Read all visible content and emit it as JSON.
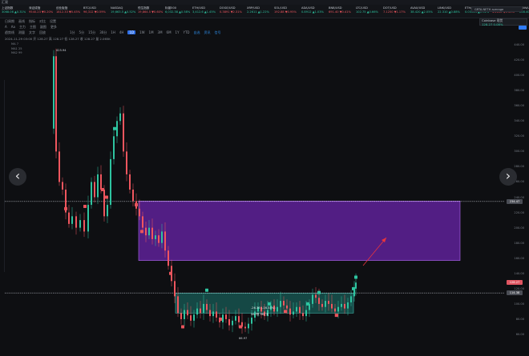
{
  "app_title": "汇观",
  "ticker": [
    {
      "name": "上证指数",
      "value": "3068.06 ▲0.31%",
      "dir": "up"
    },
    {
      "name": "深证成指",
      "value": "9540.23 ▼0.20%",
      "dir": "dn"
    },
    {
      "name": "创业板指",
      "value": "1812.33 ▼0.45%",
      "dir": "dn"
    },
    {
      "name": "BTC/USD",
      "value": "96,312 ▼0.59%",
      "dir": "dn"
    },
    {
      "name": "NASDAQ",
      "value": "19,663.5 ▲0.52%",
      "dir": "up"
    },
    {
      "name": "恒生指数",
      "value": "19,864.5 ▼0.60%",
      "dir": "dn"
    },
    {
      "name": "标普500",
      "value": "6,032.38 ▲0.58%",
      "dir": "up"
    },
    {
      "name": "ETH/USD",
      "value": "3,412.6 ▲1.45%",
      "dir": "up"
    },
    {
      "name": "DOGE/USD",
      "value": "0.3891 ▼2.31%",
      "dir": "dn"
    },
    {
      "name": "XRP/USD",
      "value": "2.2611 ▲1.22%",
      "dir": "up"
    },
    {
      "name": "SOL/USD",
      "value": "192.88 ▼0.95%",
      "dir": "dn"
    },
    {
      "name": "ADA/USD",
      "value": "0.8912 ▲1.03%",
      "dir": "up"
    },
    {
      "name": "BNB/USD",
      "value": "691.40 ▼0.41%",
      "dir": "dn"
    },
    {
      "name": "LTC/USD",
      "value": "102.75 ▲0.66%",
      "dir": "up"
    },
    {
      "name": "DOT/USD",
      "value": "7.1250 ▼1.17%",
      "dir": "dn"
    },
    {
      "name": "AVAX/USD",
      "value": "38.420 ▲2.05%",
      "dir": "up"
    },
    {
      "name": "LINK/USD",
      "value": "22.310 ▲0.88%",
      "dir": "up"
    },
    {
      "name": "ETH/BTC",
      "value": "0.03543 ▲1.92%",
      "dir": "up"
    },
    {
      "name": "SUI/USD",
      "value": "4.2610 ▼1.35%",
      "dir": "dn"
    },
    {
      "name": "COIN/USD",
      "value": "268.40 ▲0.37%",
      "dir": "up"
    }
  ],
  "search_text": "GRTA.NETH average",
  "exchange": "Coinbase 现货",
  "exchange_price": "128.27 0.08%",
  "toolbar": {
    "row1": [
      "日周期",
      "画线",
      "指标",
      "对比",
      "设置"
    ],
    "row2": [
      "A",
      "Aa",
      "主力",
      "主图",
      "副图",
      "更多"
    ],
    "row3": [
      "趋势线",
      "测量",
      "文字",
      "回放"
    ],
    "intervals": [
      "1分",
      "5分",
      "15分",
      "30分",
      "1H",
      "4H",
      "1D",
      "1W",
      "1M",
      "3M",
      "6M",
      "1Y",
      "YTD"
    ],
    "active_interval": "1D",
    "tabs": [
      "自选",
      "资讯",
      "信号"
    ]
  },
  "info_line": "2024-11-29 03:00  开 128.27  高 128.27  低 128.27  收 128.27  量 2.065K",
  "legend": [
    "MA  7",
    "MA1  25",
    "MA2  99"
  ],
  "chart": {
    "high_label": "425.94",
    "low_label": "66.97",
    "measure_label": "-26.36 (-16.33%)",
    "measure_label2": "567根  967天",
    "right_axis": [
      "440.00",
      "420.00",
      "400.00",
      "380.00",
      "360.00",
      "340.00",
      "320.00",
      "300.00",
      "280.00",
      "260.00",
      "240.00",
      "220.00",
      "200.00",
      "180.00",
      "160.00",
      "140.00",
      "120.00",
      "100.00",
      "80.00",
      "60.00"
    ],
    "price_tags": [
      {
        "value": "234.47",
        "color": "#4a4d55"
      },
      {
        "value": "128.27",
        "color": "#e05561"
      },
      {
        "value": "114.38",
        "color": "#4a4d55"
      }
    ],
    "zones": [
      {
        "name": "resistance",
        "color": "#8a2be2",
        "top_price": 235,
        "bottom_price": 157
      },
      {
        "name": "support",
        "color": "#1e8f85",
        "top_price": 114,
        "bottom_price": 88
      }
    ],
    "nav_prev": "‹",
    "nav_next": "›"
  }
}
